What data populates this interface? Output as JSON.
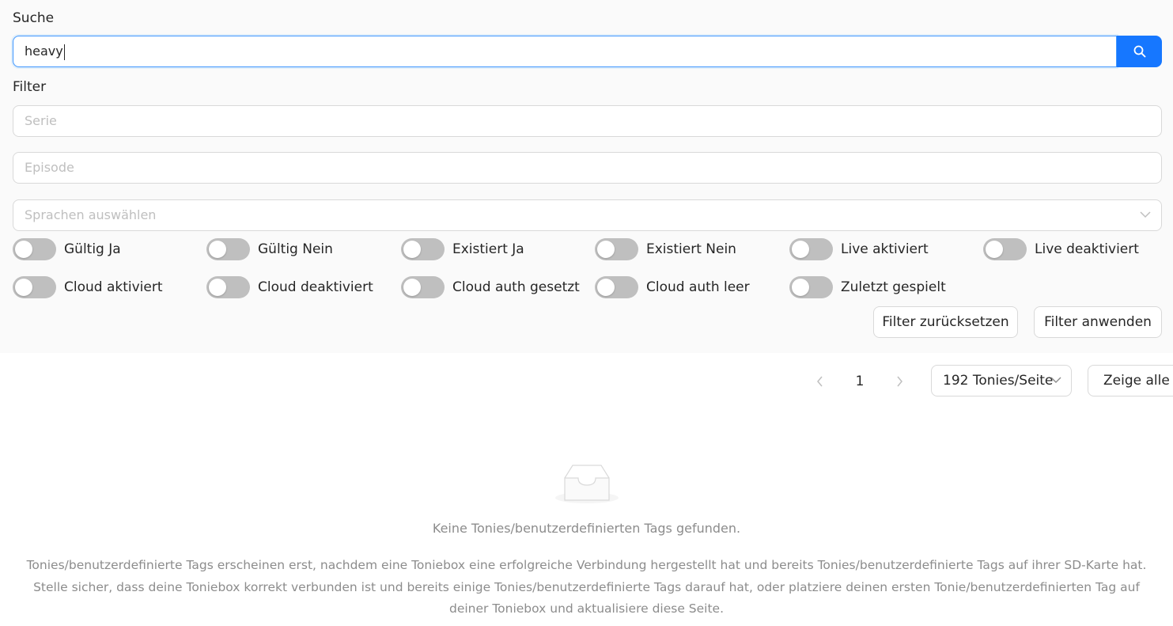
{
  "search": {
    "label": "Suche",
    "value": "heavy"
  },
  "filter": {
    "label": "Filter",
    "series_placeholder": "Serie",
    "episode_placeholder": "Episode",
    "language_placeholder": "Sprachen auswählen",
    "toggles": [
      {
        "label": "Gültig Ja",
        "on": false
      },
      {
        "label": "Gültig Nein",
        "on": false
      },
      {
        "label": "Existiert Ja",
        "on": false
      },
      {
        "label": "Existiert Nein",
        "on": false
      },
      {
        "label": "Live aktiviert",
        "on": false
      },
      {
        "label": "Live deaktiviert",
        "on": false
      },
      {
        "label": "Cloud aktiviert",
        "on": false
      },
      {
        "label": "Cloud deaktiviert",
        "on": false
      },
      {
        "label": "Cloud auth gesetzt",
        "on": false
      },
      {
        "label": "Cloud auth leer",
        "on": false
      },
      {
        "label": "Zuletzt gespielt",
        "on": false
      }
    ],
    "reset_label": "Filter zurücksetzen",
    "apply_label": "Filter anwenden"
  },
  "pagination": {
    "current_page": "1",
    "page_size_label": "192 Tonies/Seite",
    "show_all_label": "Zeige alle"
  },
  "empty": {
    "icon": "empty-inbox-icon",
    "title": "Keine Tonies/benutzerdefinierten Tags gefunden.",
    "description": "Tonies/benutzerdefinierte Tags erscheinen erst, nachdem eine Toniebox eine erfolgreiche Verbindung hergestellt hat und bereits Tonies/benutzerdefinierte Tags auf ihrer SD-Karte hat. Stelle sicher, dass deine Toniebox korrekt verbunden ist und bereits einige Tonies/benutzerdefinierte Tags darauf hat, oder platziere deinen ersten Tonie/benutzerdefinierten Tag auf deiner Toniebox und aktualisiere diese Seite."
  },
  "colors": {
    "primary": "#1677ff",
    "panel_bg": "#fafafa",
    "switch_off": "#bfbfbf",
    "muted_text": "#8c8c8c"
  }
}
